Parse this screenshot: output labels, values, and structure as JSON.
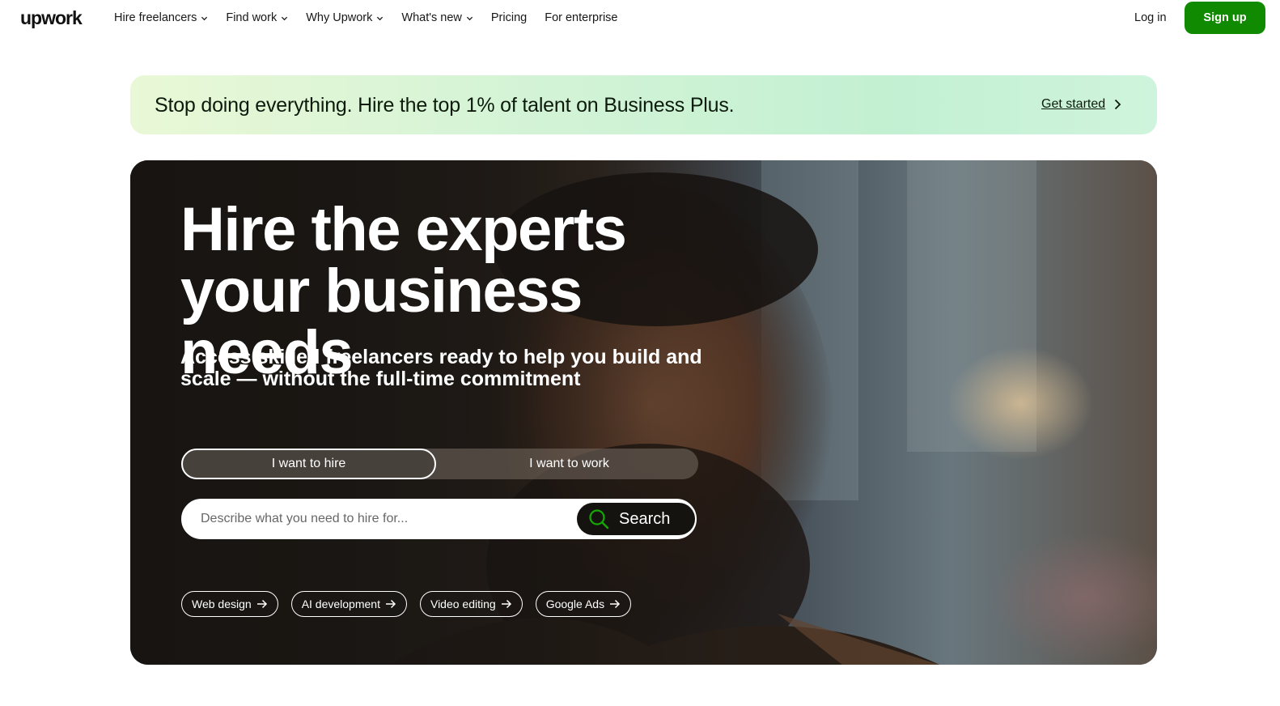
{
  "header": {
    "logo": "upwork",
    "nav": [
      {
        "label": "Hire freelancers",
        "dropdown": true
      },
      {
        "label": "Find work",
        "dropdown": true
      },
      {
        "label": "Why Upwork",
        "dropdown": true
      },
      {
        "label": "What's new",
        "dropdown": true
      },
      {
        "label": "Pricing",
        "dropdown": false
      },
      {
        "label": "For enterprise",
        "dropdown": false
      }
    ],
    "login": "Log in",
    "signup": "Sign up"
  },
  "promo": {
    "text": "Stop doing everything. Hire the top 1% of talent on Business Plus.",
    "cta": "Get started"
  },
  "hero": {
    "title": "Hire the experts your business needs",
    "subtitle": "Access skilled freelancers ready to help you build and scale — without the full-time commitment",
    "toggle": {
      "hire": "I want to hire",
      "work": "I want to work",
      "selected": "hire"
    },
    "search": {
      "placeholder": "Describe what you need to hire for...",
      "value": "",
      "button": "Search"
    },
    "chips": [
      "Web design",
      "AI development",
      "Video editing",
      "Google Ads"
    ]
  },
  "colors": {
    "brand_green": "#108a00",
    "search_icon_green": "#14a800",
    "text": "#181818"
  }
}
